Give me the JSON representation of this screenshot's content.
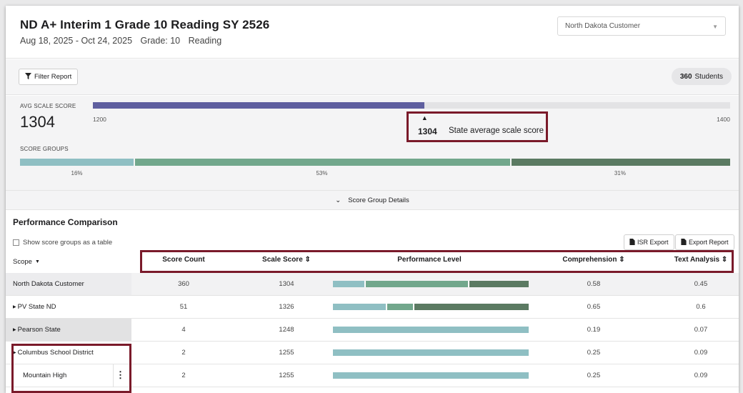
{
  "header": {
    "title": "ND A+ Interim 1 Grade 10 Reading SY 2526",
    "dates": "Aug 18, 2025 - Oct 24, 2025",
    "grade": "Grade: 10",
    "subject": "Reading",
    "customer_select": "North Dakota Customer",
    "caret_icon": "chevron-down-icon"
  },
  "toolbar": {
    "filter_label": "Filter Report",
    "filter_icon": "filter-icon",
    "students_count": "360",
    "students_label": "Students"
  },
  "summary": {
    "avg_label": "AVG SCALE SCORE",
    "avg_value": "1304",
    "scale_min": "1200",
    "scale_max": "1400",
    "avg_fraction": 0.52,
    "state_fraction": 0.52,
    "state_value": "1304",
    "state_label": "State average scale score",
    "groups_label": "SCORE GROUPS",
    "groups": [
      {
        "pct": "16%",
        "color": "#8fbfc3"
      },
      {
        "pct": "53%",
        "color": "#72a78c"
      },
      {
        "pct": "31%",
        "color": "#5b7a62"
      }
    ],
    "details_label": "Score Group Details",
    "colors": {
      "avg_fill": "#5f5f9f",
      "track": "#e3e3e5",
      "highlight_border": "#7a1a2a"
    }
  },
  "comparison": {
    "title": "Performance Comparison",
    "show_groups_label": "Show score groups as a table",
    "isr_export": "ISR Export",
    "export_report": "Export Report",
    "columns": {
      "scope": "Scope",
      "score_count": "Score Count",
      "scale_score": "Scale Score",
      "performance_level": "Performance Level",
      "comprehension": "Comprehension",
      "text_analysis": "Text Analysis"
    },
    "rows": [
      {
        "name": "North Dakota Customer",
        "count": "360",
        "scale": "1304",
        "comp": "0.58",
        "ta": "0.45",
        "levels": [
          0.16,
          0.53,
          0.31
        ],
        "highlight": true,
        "arrow": false
      },
      {
        "name": "PV State ND",
        "count": "51",
        "scale": "1326",
        "comp": "0.65",
        "ta": "0.6",
        "levels": [
          0.27,
          0.14,
          0.59
        ],
        "highlight": false,
        "arrow": true
      },
      {
        "name": "Pearson State",
        "count": "4",
        "scale": "1248",
        "comp": "0.19",
        "ta": "0.07",
        "levels": [
          1.0,
          0,
          0
        ],
        "highlight": false,
        "arrow": true,
        "scope_grey": true
      },
      {
        "name": "Columbus School District",
        "count": "2",
        "scale": "1255",
        "comp": "0.25",
        "ta": "0.09",
        "levels": [
          1.0,
          0,
          0
        ],
        "highlight": false,
        "arrow": true
      },
      {
        "name": "Mountain High",
        "count": "2",
        "scale": "1255",
        "comp": "0.25",
        "ta": "0.09",
        "levels": [
          1.0,
          0,
          0
        ],
        "highlight": false,
        "arrow": false,
        "menu": true
      }
    ]
  }
}
